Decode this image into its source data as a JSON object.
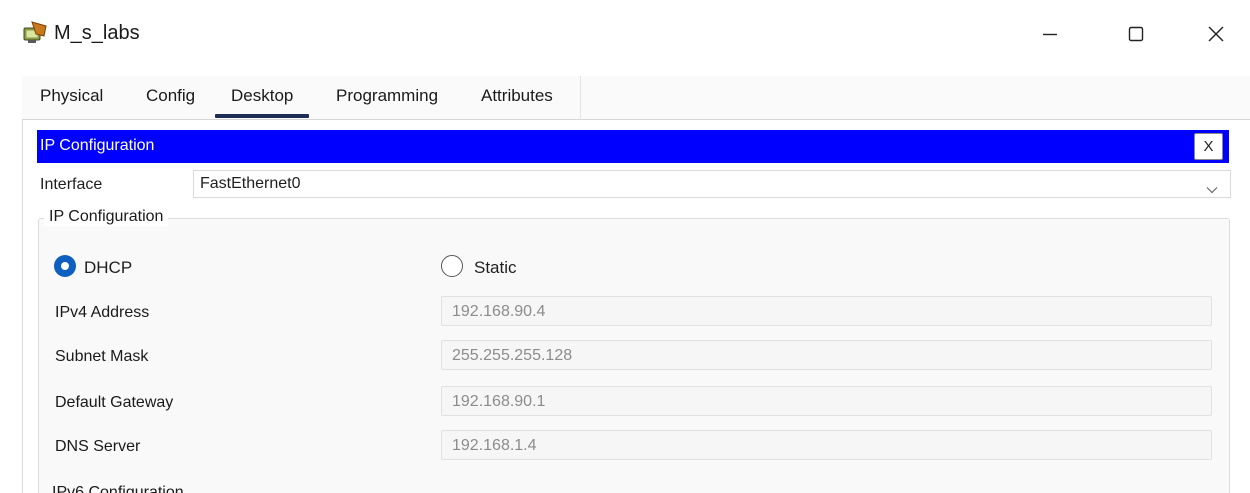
{
  "window": {
    "title": "M_s_labs",
    "icon": "packet-tracer-pc-icon",
    "controls": [
      "minimize-icon",
      "maximize-icon",
      "close-icon"
    ]
  },
  "tabs": [
    {
      "label": "Physical",
      "active": false
    },
    {
      "label": "Config",
      "active": false
    },
    {
      "label": "Desktop",
      "active": true
    },
    {
      "label": "Programming",
      "active": false
    },
    {
      "label": "Attributes",
      "active": false
    }
  ],
  "ip_config_window": {
    "title": "IP Configuration",
    "close_label": "X",
    "header_color": "#0000ff"
  },
  "interface": {
    "label": "Interface",
    "value": "FastEthernet0"
  },
  "ipv4_group": {
    "legend": "IP Configuration",
    "mode": {
      "dhcp_label": "DHCP",
      "static_label": "Static",
      "selected": "DHCP"
    },
    "fields": [
      {
        "label": "IPv4 Address",
        "value": "192.168.90.4"
      },
      {
        "label": "Subnet Mask",
        "value": "255.255.255.128"
      },
      {
        "label": "Default Gateway",
        "value": "192.168.90.1"
      },
      {
        "label": "DNS Server",
        "value": "192.168.1.4"
      }
    ]
  },
  "ipv6_group": {
    "legend": "IPv6 Configuration"
  },
  "colors": {
    "accent": "#0f5fc0",
    "tab_underline": "#1e2d54"
  }
}
